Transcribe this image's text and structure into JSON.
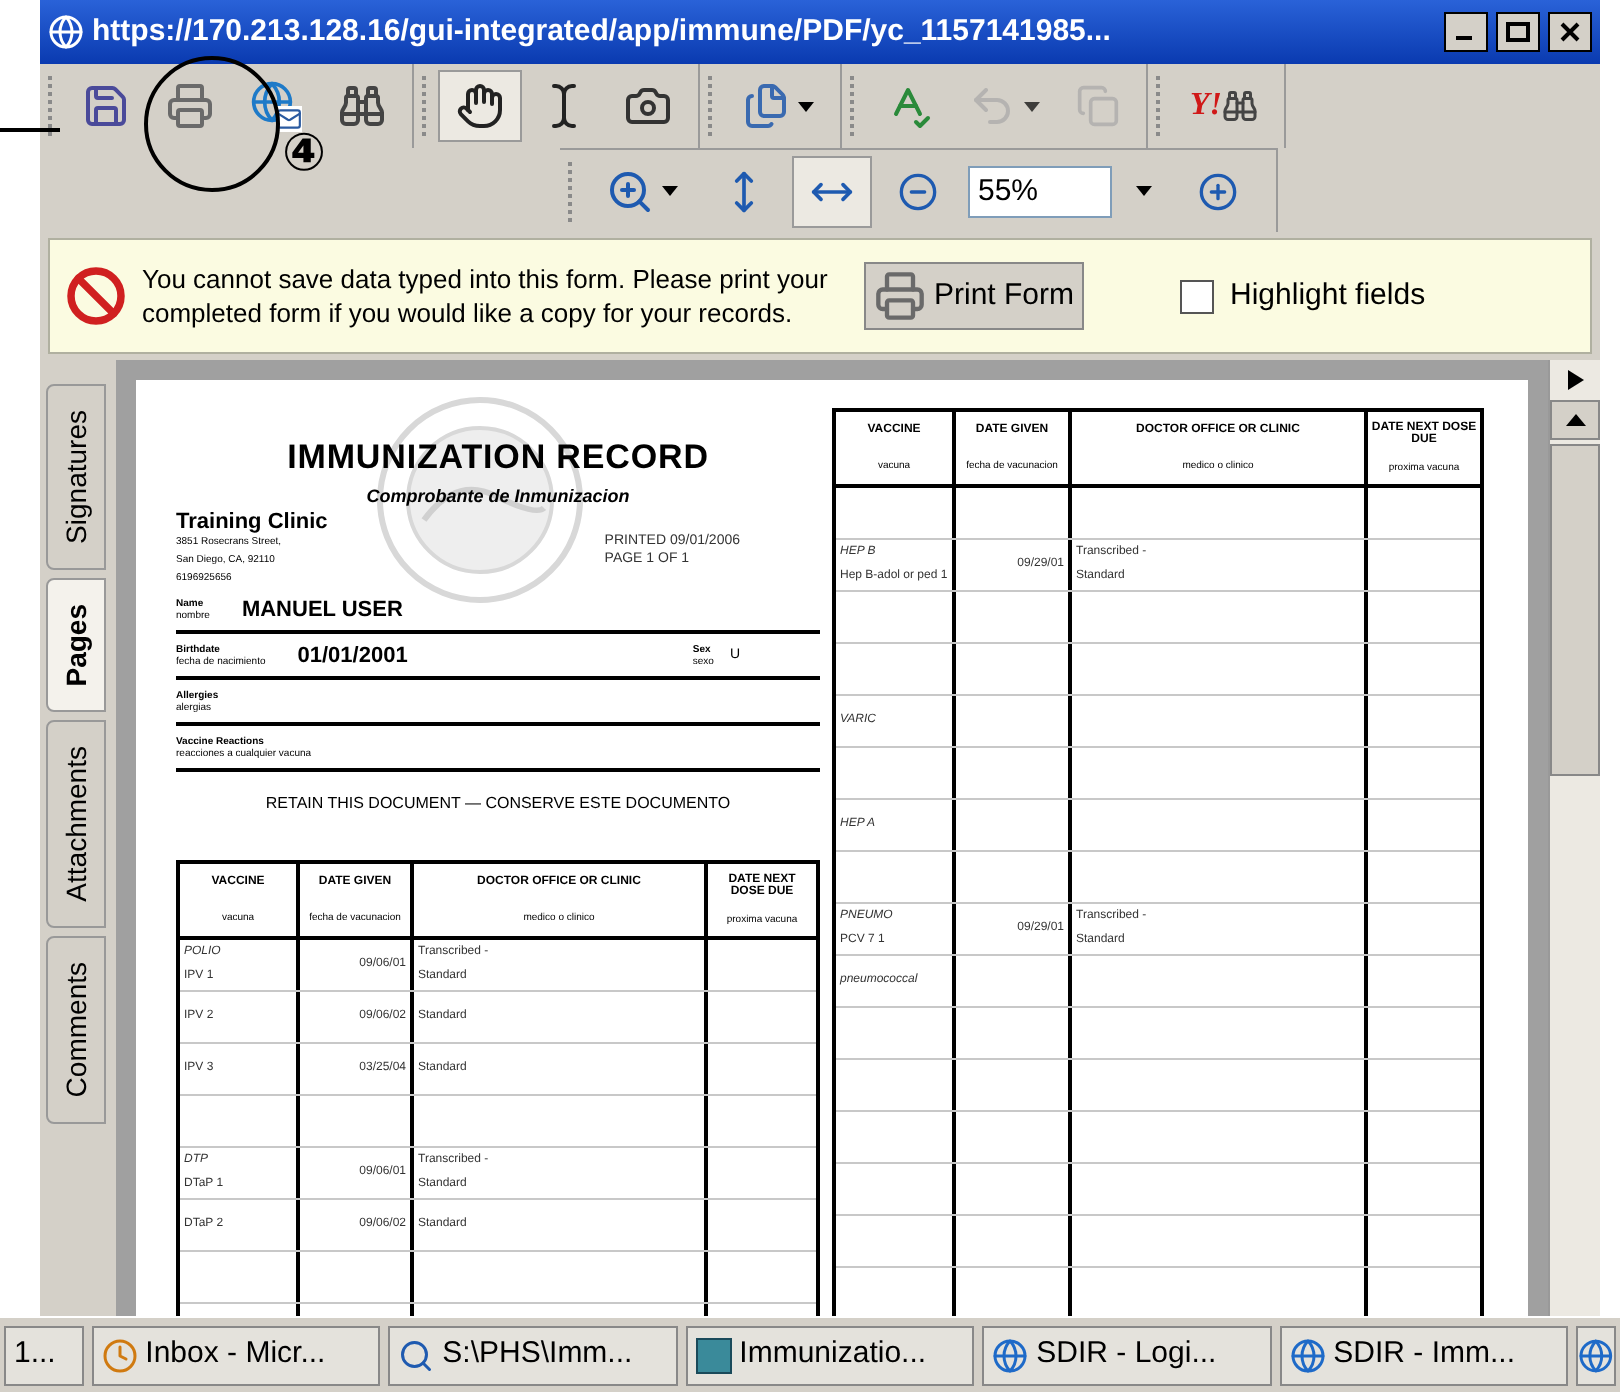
{
  "window": {
    "title": "https://170.213.128.16/gui-integrated/app/immune/PDF/yc_1157141985..."
  },
  "toolbar": {
    "groups": [
      [
        {
          "kind": "save",
          "selected": false,
          "dropdown": false,
          "disabled": false
        },
        {
          "kind": "print",
          "selected": false,
          "dropdown": false,
          "disabled": false
        },
        {
          "kind": "email",
          "selected": false,
          "dropdown": false,
          "disabled": false
        },
        {
          "kind": "find",
          "selected": false,
          "dropdown": false,
          "disabled": false
        }
      ],
      [
        {
          "kind": "hand",
          "selected": true,
          "dropdown": false,
          "disabled": false
        },
        {
          "kind": "select",
          "selected": false,
          "dropdown": false,
          "disabled": false
        },
        {
          "kind": "snapshot",
          "selected": false,
          "dropdown": false,
          "disabled": false
        }
      ],
      [
        {
          "kind": "pages",
          "selected": false,
          "dropdown": true,
          "disabled": false
        }
      ],
      [
        {
          "kind": "spell",
          "selected": false,
          "dropdown": false,
          "disabled": false
        },
        {
          "kind": "undo",
          "selected": false,
          "dropdown": true,
          "disabled": true
        },
        {
          "kind": "copy",
          "selected": false,
          "dropdown": false,
          "disabled": true
        }
      ],
      [
        {
          "kind": "yahoo",
          "label": "Y!",
          "selected": false,
          "dropdown": false,
          "disabled": false
        }
      ]
    ]
  },
  "zoom_toolbar": {
    "items": [
      {
        "kind": "zoom_tool",
        "selected": false,
        "dropdown": true
      },
      {
        "kind": "fit_page",
        "selected": false,
        "dropdown": false
      },
      {
        "kind": "fit_width",
        "selected": true,
        "dropdown": false
      },
      {
        "kind": "zoom_out",
        "selected": false,
        "dropdown": false
      },
      {
        "kind": "zoom_field",
        "value": "55%",
        "dropdown": true
      },
      {
        "kind": "zoom_in",
        "selected": false,
        "dropdown": false
      }
    ]
  },
  "annotation": {
    "number": "④"
  },
  "info_bar": {
    "message": "You cannot save data typed into this form. Please print your completed form if you would like a copy for your records.",
    "button": "Print Form",
    "checkbox": {
      "label": "Highlight fields",
      "checked": false
    }
  },
  "side_tabs": [
    {
      "label": "Signatures",
      "selected": false
    },
    {
      "label": "Pages",
      "selected": true
    },
    {
      "label": "Attachments",
      "selected": false
    },
    {
      "label": "Comments",
      "selected": false
    }
  ],
  "document": {
    "title": "IMMUNIZATION RECORD",
    "subtitle": "Comprobante de Inmunizacion",
    "clinic": "Training Clinic",
    "address": [
      "3851 Rosecrans Street,",
      "San Diego, CA, 92110",
      "6196925656"
    ],
    "printed": "PRINTED 09/01/2006",
    "page": "PAGE 1 OF 1",
    "fields": [
      {
        "kind": "name",
        "label": "Name",
        "label_es": "nombre",
        "value": "MANUEL USER"
      },
      {
        "kind": "birthdate",
        "label": "Birthdate",
        "label_es": "fecha de nacimiento",
        "value": "01/01/2001",
        "extra_label": "Sex",
        "extra_label_es": "sexo",
        "extra_value": "U"
      },
      {
        "kind": "plain",
        "label": "Allergies",
        "label_es": "alergias"
      },
      {
        "kind": "plain",
        "label": "Vaccine Reactions",
        "label_es": "reacciones a cualquier vacuna"
      }
    ],
    "retain_note": "RETAIN THIS DOCUMENT — CONSERVE ESTE DOCUMENTO",
    "left_table": {
      "columns": [
        {
          "heading": "VACCINE",
          "heading_es": "vacuna"
        },
        {
          "heading": "DATE GIVEN",
          "heading_es": "fecha de vacunacion"
        },
        {
          "heading": "DOCTOR OFFICE OR CLINIC",
          "heading_es": "medico o clinico"
        },
        {
          "heading": "DATE NEXT DOSE DUE",
          "heading_es": "proxima vacuna"
        }
      ],
      "rows": [
        {
          "group": "POLIO",
          "vaccine": "IPV 1",
          "date": "09/06/01",
          "note": "Transcribed -",
          "clinic": "Standard"
        },
        {
          "vaccine": "IPV 2",
          "date": "09/06/02",
          "clinic": "Standard"
        },
        {
          "vaccine": "IPV 3",
          "date": "03/25/04",
          "clinic": "Standard"
        },
        {},
        {
          "group": "DTP",
          "vaccine": "DTaP 1",
          "date": "09/06/01",
          "note": "Transcribed -",
          "clinic": "Standard"
        },
        {
          "vaccine": "DTaP 2",
          "date": "09/06/02",
          "clinic": "Standard"
        },
        {}
      ]
    },
    "right_table": {
      "columns": [
        {
          "heading": "VACCINE",
          "heading_es": "vacuna"
        },
        {
          "heading": "DATE GIVEN",
          "heading_es": "fecha de vacunacion"
        },
        {
          "heading": "DOCTOR OFFICE OR CLINIC",
          "heading_es": "medico o clinico"
        },
        {
          "heading": "DATE NEXT DOSE DUE",
          "heading_es": "proxima vacuna"
        }
      ],
      "rows": [
        {},
        {
          "group": "HEP B",
          "vaccine": "Hep B-adol or ped 1",
          "date": "09/29/01",
          "note": "Transcribed -",
          "clinic": "Standard"
        },
        {},
        {},
        {
          "group": "VARIC"
        },
        {},
        {
          "group": "HEP A"
        },
        {},
        {
          "group": "PNEUMO",
          "vaccine": "PCV 7 1",
          "date": "09/29/01",
          "note": "Transcribed -",
          "clinic": "Standard"
        },
        {
          "group": "pneumococcal"
        },
        {},
        {},
        {},
        {},
        {},
        {}
      ]
    }
  },
  "taskbar": [
    {
      "kind": "blank",
      "label": "1..."
    },
    {
      "kind": "clock",
      "label": "Inbox - Micr..."
    },
    {
      "kind": "search",
      "label": "S:\\PHS\\Imm..."
    },
    {
      "kind": "publisher",
      "label": "Immunizatio..."
    },
    {
      "kind": "browser",
      "label": "SDIR - Logi..."
    },
    {
      "kind": "browser",
      "label": "SDIR - Imm..."
    }
  ]
}
